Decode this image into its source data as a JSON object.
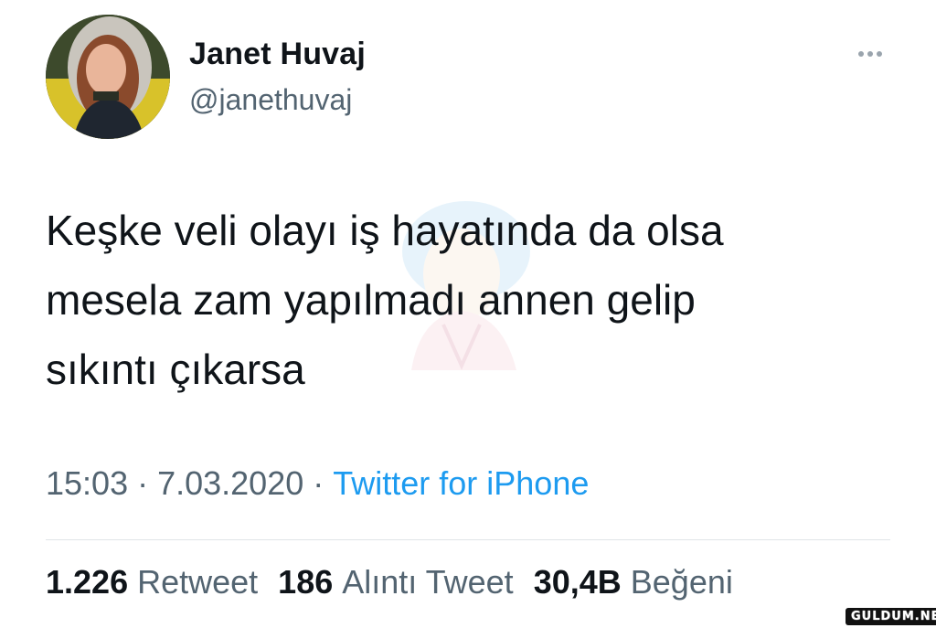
{
  "user": {
    "display_name": "Janet Huvaj",
    "handle": "@janethuvaj"
  },
  "tweet": {
    "text": "Keşke veli olayı iş hayatında da olsa\nmesela zam yapılmadı annen gelip\nsıkıntı çıkarsa"
  },
  "meta": {
    "time": "15:03",
    "separator": "·",
    "date": "7.03.2020",
    "source": "Twitter for iPhone"
  },
  "stats": {
    "retweets": {
      "count": "1.226",
      "label": "Retweet"
    },
    "quotes": {
      "count": "186",
      "label": "Alıntı Tweet"
    },
    "likes": {
      "count": "30,4B",
      "label": "Beğeni"
    }
  },
  "watermark_text": "GULDUM.NET",
  "icons": {
    "more": "more-horizontal-icon"
  },
  "colors": {
    "name": "#0f1419",
    "secondary": "#536471",
    "link": "#1d9bf0",
    "divider": "#e1e5e8"
  }
}
